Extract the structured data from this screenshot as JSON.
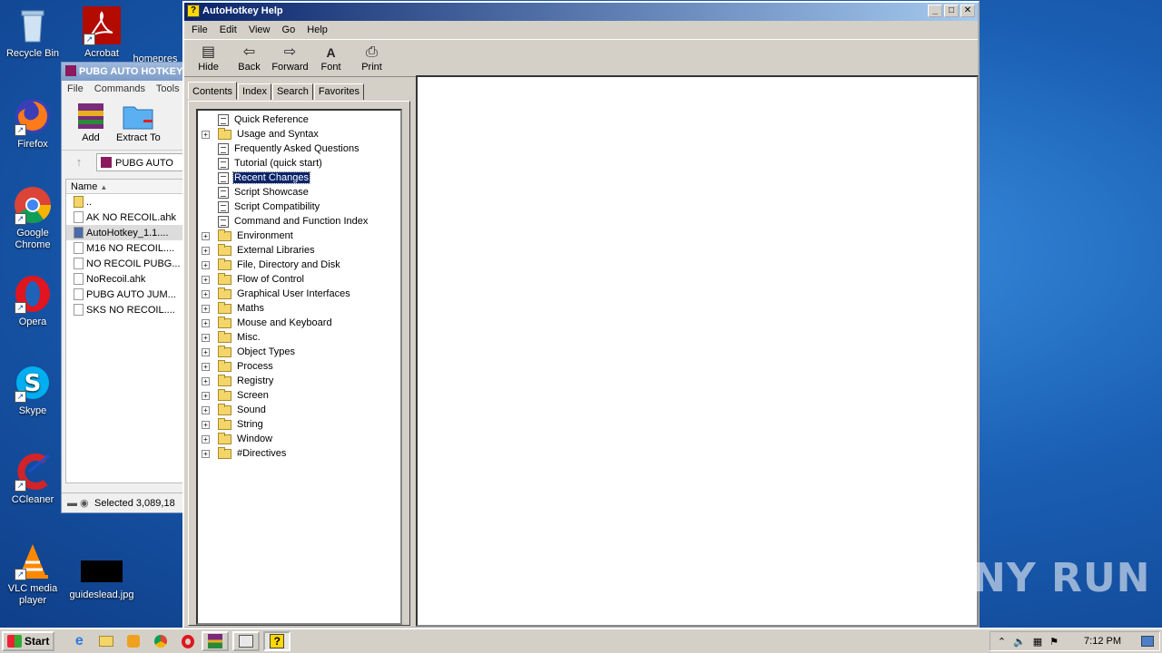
{
  "desktop": {
    "icons": [
      {
        "label": "Recycle Bin"
      },
      {
        "label": "Acrobat"
      },
      {
        "label": "homepres"
      },
      {
        "label": "Firefox"
      },
      {
        "label": "Google Chrome"
      },
      {
        "label": "Opera"
      },
      {
        "label": "Skype"
      },
      {
        "label": "CCleaner"
      },
      {
        "label": "VLC media player"
      },
      {
        "label": "guideslead.jpg"
      }
    ]
  },
  "winrar": {
    "title": "PUBG AUTO HOTKEY",
    "menu": [
      "File",
      "Commands",
      "Tools"
    ],
    "tools": [
      {
        "label": "Add"
      },
      {
        "label": "Extract To"
      }
    ],
    "address": "PUBG AUTO",
    "column_name": "Name",
    "files": [
      "..",
      "AK NO RECOIL.ahk",
      "AutoHotkey_1.1....",
      "M16 NO RECOIL....",
      "NO RECOIL PUBG...",
      "NoRecoil.ahk",
      "PUBG AUTO JUM...",
      "SKS NO RECOIL...."
    ],
    "status": "Selected 3,089,18"
  },
  "help": {
    "title": "AutoHotkey Help",
    "menu": [
      "File",
      "Edit",
      "View",
      "Go",
      "Help"
    ],
    "toolbar": [
      {
        "label": "Hide",
        "icon": "hide-icon"
      },
      {
        "label": "Back",
        "icon": "back-arrow-icon"
      },
      {
        "label": "Forward",
        "icon": "forward-arrow-icon"
      },
      {
        "label": "Font",
        "icon": "font-icon"
      },
      {
        "label": "Print",
        "icon": "printer-icon"
      }
    ],
    "tabs": [
      "Contents",
      "Index",
      "Search",
      "Favorites"
    ],
    "tree": [
      {
        "label": "Quick Reference",
        "kind": "page"
      },
      {
        "label": "Usage and Syntax",
        "kind": "folder"
      },
      {
        "label": "Frequently Asked Questions",
        "kind": "page"
      },
      {
        "label": "Tutorial (quick start)",
        "kind": "page"
      },
      {
        "label": "Recent Changes",
        "kind": "page",
        "selected": true
      },
      {
        "label": "Script Showcase",
        "kind": "page"
      },
      {
        "label": "Script Compatibility",
        "kind": "page"
      },
      {
        "label": "Command and Function Index",
        "kind": "page"
      },
      {
        "label": "Environment",
        "kind": "folder"
      },
      {
        "label": "External Libraries",
        "kind": "folder"
      },
      {
        "label": "File, Directory and Disk",
        "kind": "folder"
      },
      {
        "label": "Flow of Control",
        "kind": "folder"
      },
      {
        "label": "Graphical User Interfaces",
        "kind": "folder"
      },
      {
        "label": "Maths",
        "kind": "folder"
      },
      {
        "label": "Mouse and Keyboard",
        "kind": "folder"
      },
      {
        "label": "Misc.",
        "kind": "folder"
      },
      {
        "label": "Object Types",
        "kind": "folder"
      },
      {
        "label": "Process",
        "kind": "folder"
      },
      {
        "label": "Registry",
        "kind": "folder"
      },
      {
        "label": "Screen",
        "kind": "folder"
      },
      {
        "label": "Sound",
        "kind": "folder"
      },
      {
        "label": "String",
        "kind": "folder"
      },
      {
        "label": "Window",
        "kind": "folder"
      },
      {
        "label": "#Directives",
        "kind": "folder"
      }
    ]
  },
  "watermark": "ANY RUN",
  "taskbar": {
    "start_label": "Start",
    "clock": "7:12 PM"
  }
}
